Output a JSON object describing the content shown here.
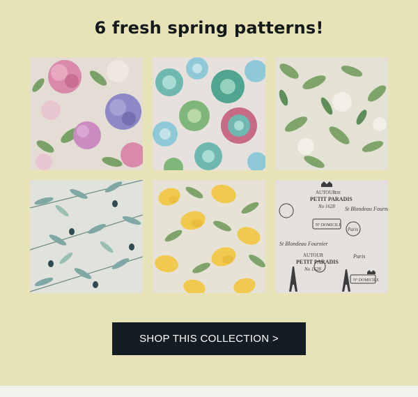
{
  "headline": "6 fresh spring patterns!",
  "cta": {
    "label": "SHOP THIS COLLECTION >"
  },
  "patterns": [
    {
      "motif": "hydrangea-florals",
      "background": "#e4ddd4",
      "colors": [
        "#d98aaa",
        "#8e89c6",
        "#6f9b5c",
        "#c98bc0",
        "#e8c6d0"
      ]
    },
    {
      "motif": "succulents",
      "background": "#e6e1dc",
      "colors": [
        "#6fb8b0",
        "#8fc9d8",
        "#7fb77a",
        "#c76a86",
        "#a9cfc2"
      ]
    },
    {
      "motif": "magnolia-leaves",
      "background": "#e3e2d5",
      "colors": [
        "#7ea46a",
        "#5f8e58",
        "#f1efe6",
        "#a7c191"
      ]
    },
    {
      "motif": "olive-branches",
      "background": "#dfe3dc",
      "colors": [
        "#7ea7a6",
        "#4b6f7a",
        "#9bbfb3",
        "#2f4a52"
      ]
    },
    {
      "motif": "lemons",
      "background": "#e6e2d6",
      "colors": [
        "#f0c94e",
        "#e8b83a",
        "#7fa36a",
        "#5e8a52"
      ]
    },
    {
      "motif": "paris-stamps",
      "background": "#e4e0dd",
      "colors": [
        "#3c3b3d",
        "#6a686c",
        "#9e9ca0"
      ],
      "texts": {
        "autour": "AUTOUR",
        "de": "DE",
        "petit_paradis": "PETIT PARADIS",
        "no_year": "No 1628",
        "paris": "Paris",
        "script_name": "St Blondeau Fournier",
        "domicile": "Nº DOMICILE"
      }
    }
  ]
}
